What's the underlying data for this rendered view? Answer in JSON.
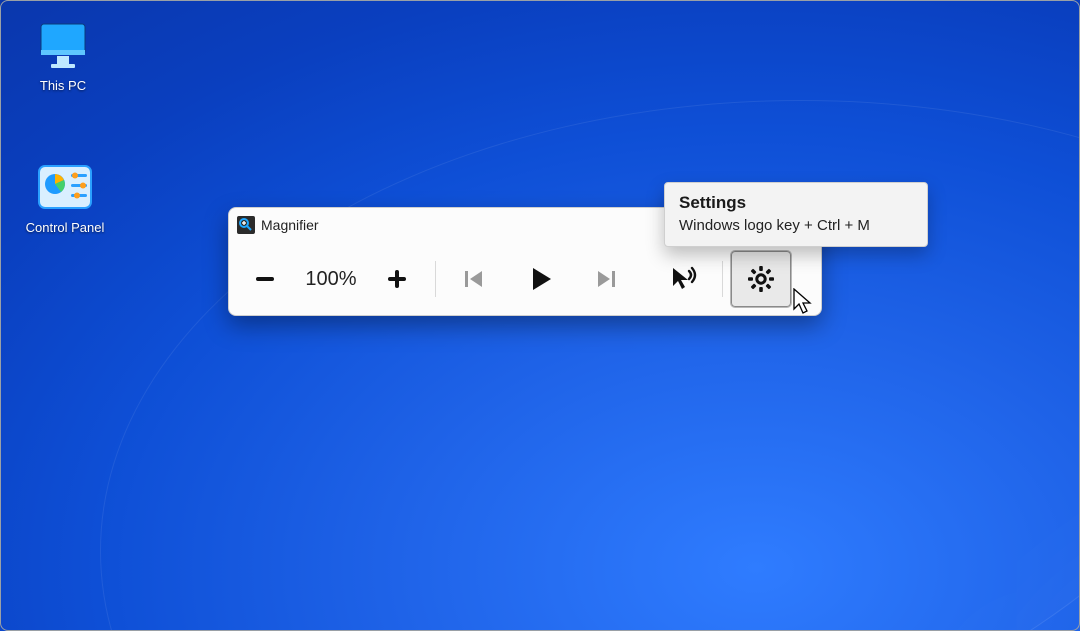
{
  "desktop": {
    "icons": {
      "this_pc": {
        "label": "This PC"
      },
      "control_panel": {
        "label": "Control Panel"
      }
    }
  },
  "magnifier": {
    "title": "Magnifier",
    "zoom_level": "100%",
    "buttons": {
      "zoom_out": "zoom-out",
      "zoom_in": "zoom-in",
      "previous": "previous",
      "play": "play",
      "next": "next",
      "read_from_here": "read-aloud-from-here",
      "settings": "settings"
    }
  },
  "tooltip": {
    "title": "Settings",
    "shortcut": "Windows logo key + Ctrl + M"
  }
}
